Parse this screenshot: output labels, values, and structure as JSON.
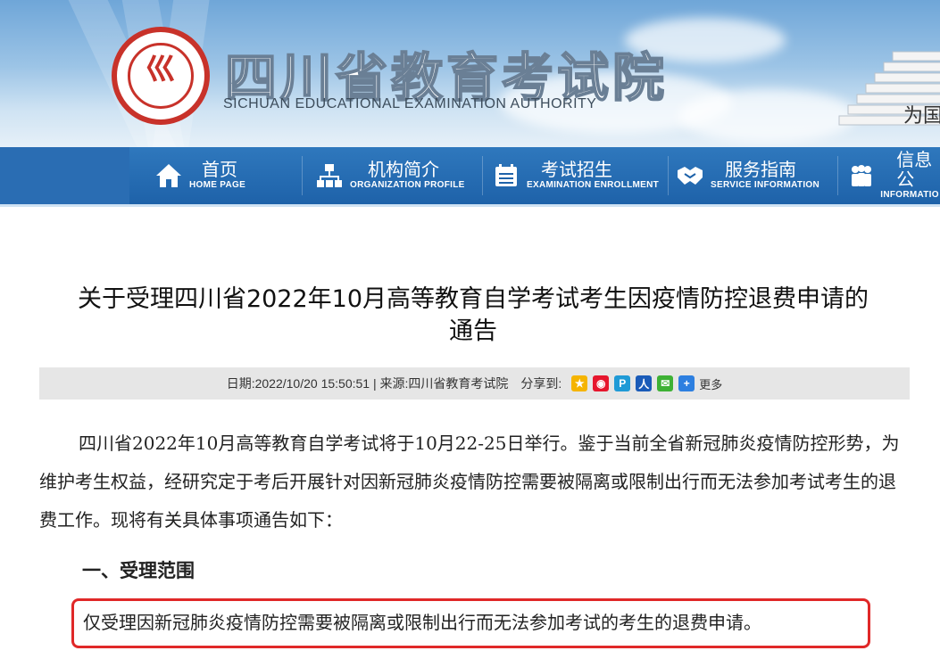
{
  "header": {
    "logo_glyph": "巛",
    "org_name": "四川省教育考试院",
    "org_name_en": "SICHUAN EDUCATIONAL EXAMINATION AUTHORITY",
    "slogan": "为国"
  },
  "nav": {
    "items": [
      {
        "cn": "首页",
        "en": "HOME PAGE",
        "icon": "home-icon"
      },
      {
        "cn": "机构简介",
        "en": "ORGANIZATION PROFILE",
        "icon": "org-chart-icon"
      },
      {
        "cn": "考试招生",
        "en": "EXAMINATION ENROLLMENT",
        "icon": "calendar-icon"
      },
      {
        "cn": "服务指南",
        "en": "SERVICE INFORMATION",
        "icon": "handshake-icon"
      },
      {
        "cn": "信息公",
        "en": "INFORMATIO",
        "icon": "people-icon"
      }
    ]
  },
  "article": {
    "title_line1": "关于受理四川省2022年10月高等教育自学考试考生因疫情防控退费申请的",
    "title_line2": "通告",
    "meta_date": "日期:2022/10/20 15:50:51 | 来源:四川省教育考试院",
    "share_label": "分享到:",
    "share_more": "更多",
    "para1": "四川省2022年10月高等教育自学考试将于10月22-25日举行。鉴于当前全省新冠肺炎疫情防控形势，为维护考生权益，经研究定于考后开展针对因新冠肺炎疫情防控需要被隔离或限制出行而无法参加考试考生的退费工作。现将有关具体事项通告如下：",
    "section1_heading": "一、受理范围",
    "section1_text": "仅受理因新冠肺炎疫情防控需要被隔离或限制出行而无法参加考试的考生的退费申请。"
  },
  "colors": {
    "nav_bg": "#1e62a9",
    "highlight_border": "#e02828",
    "meta_bg": "#e6e6e6"
  }
}
